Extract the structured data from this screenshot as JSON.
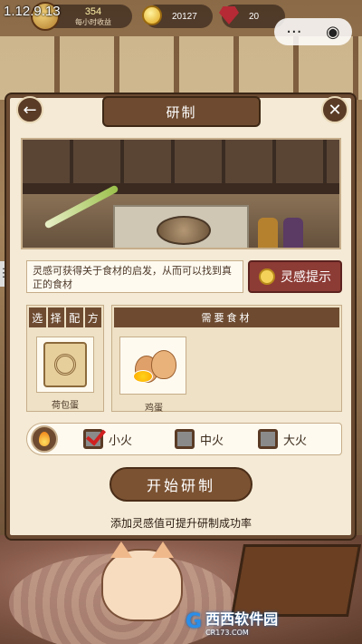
{
  "hud": {
    "version": "1.12.9.13",
    "income_value": "354",
    "income_label": "每小时收益",
    "coins": "20127",
    "gems": "20",
    "mini_more": "···",
    "mini_close": "◉"
  },
  "panel": {
    "title": "研制",
    "back_icon": "back-arrow-icon",
    "close_icon": "close-x-icon"
  },
  "hint": {
    "text": "灵感可获得关于食材的启发，从而可以找到真正的食材",
    "button_label": "灵感提示"
  },
  "recipe": {
    "header": [
      "选",
      "择",
      "配",
      "方"
    ],
    "item_name": "荷包蛋"
  },
  "ingredients": {
    "header": "需要食材",
    "items": [
      {
        "name": "鸡蛋"
      }
    ]
  },
  "heat": {
    "options": [
      {
        "label": "小火",
        "checked": true
      },
      {
        "label": "中火",
        "checked": false
      },
      {
        "label": "大火",
        "checked": false
      }
    ]
  },
  "actions": {
    "start_label": "开始研制",
    "tip": "添加灵感值可提升研制成功率"
  },
  "side_tab": "☰",
  "watermark": {
    "brand": "西西软件园",
    "url": "CR173.COM"
  }
}
